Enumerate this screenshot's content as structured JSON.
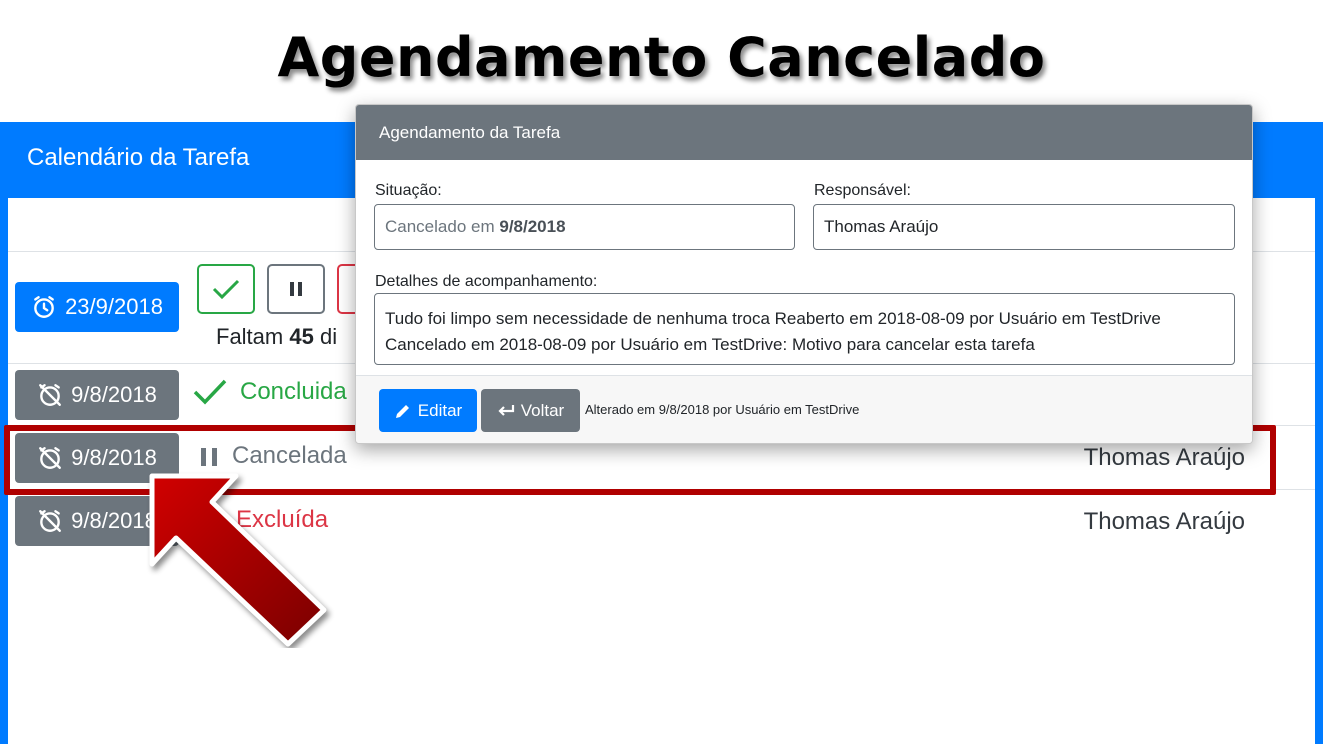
{
  "headline": "Agendamento Cancelado",
  "app": {
    "title": "Calendário da Tarefa"
  },
  "rows": [
    {
      "date": "23/9/2018",
      "remaining_prefix": "Faltam",
      "remaining_days": "45",
      "remaining_suffix": "di"
    },
    {
      "date": "9/8/2018",
      "status": "Concluida"
    },
    {
      "date": "9/8/2018",
      "status": "Cancelada",
      "responsible": "Thomas Araújo"
    },
    {
      "date": "9/8/2018",
      "status": "Excluída",
      "responsible": "Thomas Araújo"
    }
  ],
  "modal": {
    "title": "Agendamento da Tarefa",
    "situacao_label": "Situação:",
    "situacao_prefix": "Cancelado em",
    "situacao_date": "9/8/2018",
    "responsavel_label": "Responsável:",
    "responsavel_value": "Thomas Araújo",
    "details_label": "Detalhes de acompanhamento:",
    "details_line1": "Tudo foi limpo sem necessidade de nenhuma troca Reaberto em 2018-08-09 por Usuário em TestDrive",
    "details_line2": "Cancelado em 2018-08-09 por Usuário em TestDrive: Motivo para cancelar esta tarefa",
    "edit_label": "Editar",
    "back_label": "Voltar",
    "footer_note": "Alterado em 9/8/2018 por Usuário em TestDrive"
  },
  "colors": {
    "primary": "#007bff",
    "secondary": "#6c757d",
    "success": "#28a745",
    "danger": "#dc3545",
    "highlight": "#b00000"
  },
  "icons": [
    "alarm-clock-icon",
    "alarm-off-icon",
    "check-icon",
    "pause-icon",
    "pencil-icon",
    "back-arrow-icon"
  ]
}
